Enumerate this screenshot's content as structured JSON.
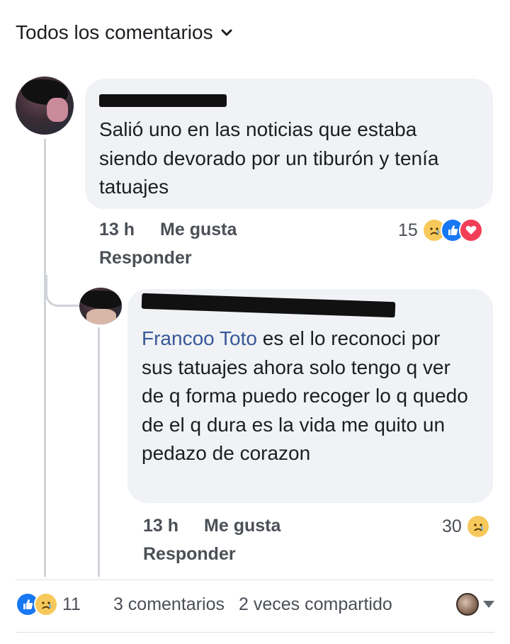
{
  "header": {
    "title": "Todos los comentarios"
  },
  "comments": [
    {
      "text": "Salió uno en las noticias que estaba siendo devorado por un tiburón y tenía tatuajes",
      "time": "13 h",
      "like_label": "Me gusta",
      "reply_label": "Responder",
      "reaction_count": "15"
    },
    {
      "mention": "Francoo Toto",
      "text": " es el lo reconoci por sus tatuajes ahora solo tengo q ver de q forma puedo recoger lo q quedo de el q dura es la vida me quito un pedazo de corazon",
      "time": "13 h",
      "like_label": "Me gusta",
      "reply_label": "Responder",
      "reaction_count": "30"
    }
  ],
  "footer": {
    "reaction_count": "11",
    "comments": "3 comentarios",
    "shares": "2 veces compartido"
  },
  "colors": {
    "mention": "#385898",
    "like": "#1877f2",
    "love": "#f33e58",
    "sad": "#f7c85b"
  },
  "icons": [
    "chevron-down-icon",
    "sad-reaction-icon",
    "like-reaction-icon",
    "love-reaction-icon",
    "dropdown-arrow-icon"
  ]
}
